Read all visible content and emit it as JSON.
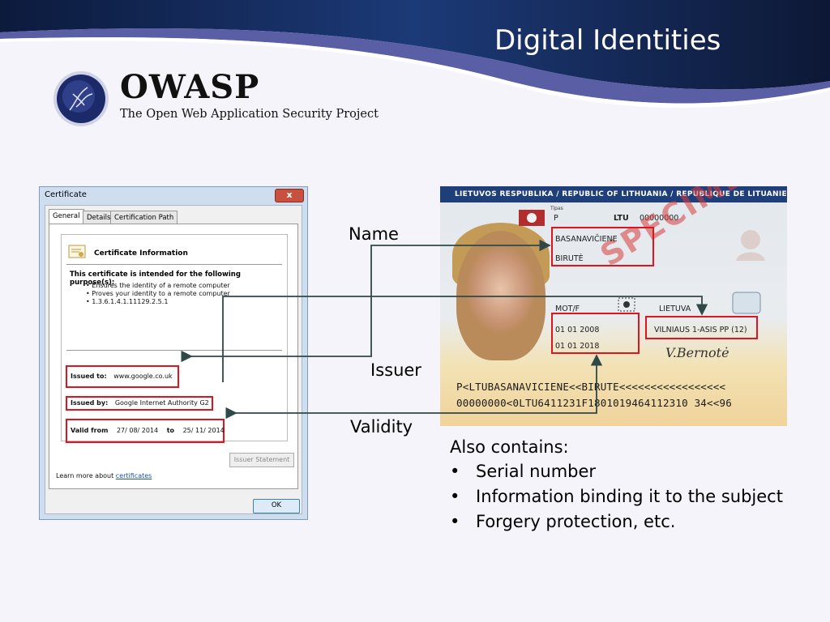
{
  "slide": {
    "title": "Digital Identities"
  },
  "owasp": {
    "name": "OWASP",
    "tagline": "The Open Web Application Security Project"
  },
  "certificate_dialog": {
    "title": "Certificate",
    "close": "x",
    "tabs": [
      "General",
      "Details",
      "Certification Path"
    ],
    "info_title": "Certificate Information",
    "purpose_heading": "This certificate is intended for the following purpose(s):",
    "purposes": [
      "• Ensures the identity of a remote computer",
      "• Proves your identity to a remote computer",
      "• 1.3.6.1.4.1.11129.2.5.1"
    ],
    "issued_to_label": "Issued to:",
    "issued_to_value": "www.google.co.uk",
    "issued_by_label": "Issued by:",
    "issued_by_value": "Google Internet Authority G2",
    "valid_from_label": "Valid from",
    "valid_from_value": "27/ 08/ 2014",
    "valid_to_label": "to",
    "valid_to_value": "25/ 11/ 2014",
    "issuer_statement_button": "Issuer Statement",
    "learn_more_prefix": "Learn more about ",
    "learn_more_link": "certificates",
    "ok_button": "OK"
  },
  "id_card": {
    "header": "LIETUVOS RESPUBLIKA / REPUBLIC OF LITHUANIA / REPUBLIQUE DE LITUANIE",
    "type": "P",
    "country": "LTU",
    "passport_no": "00000000",
    "surname": "BASANAVIČIENE",
    "given_name": "BIRUTĖ",
    "sex": "MOT/F",
    "nationality": "LIETUVA",
    "issue_date": "01 01 2008",
    "expiry_date": "01 01 2018",
    "authority": "VILNIAUS 1-ASIS PP (12)",
    "watermark": "SPECIMEN",
    "mrz_line1": "P<LTUBASANAVICIENE<<BIRUTE<<<<<<<<<<<<<<<<<",
    "mrz_line2": "00000000<0LTU6411231F1801019464112310 34<<96"
  },
  "labels": {
    "name": "Name",
    "issuer": "Issuer",
    "validity": "Validity"
  },
  "also_contains": {
    "heading": "Also contains:",
    "items": [
      "Serial number",
      "Information binding it to the subject",
      "Forgery protection, etc."
    ]
  },
  "colors": {
    "highlight": "#e0141e",
    "arrow": "#2f4848",
    "banner_dark": "#0f1f4a",
    "banner_purple": "#5a5ea4"
  }
}
